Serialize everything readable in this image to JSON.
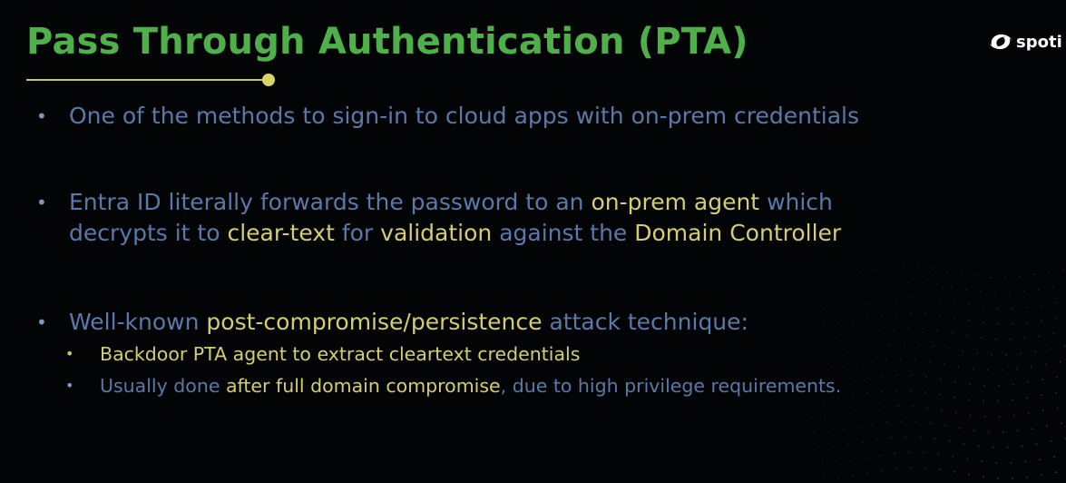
{
  "slide": {
    "title": "Pass Through Authentication (PTA)",
    "brand": {
      "name": "spoti",
      "icon": "spotit-swirl-logo-icon"
    },
    "colors": {
      "title": "#4fb04a",
      "body_text": "#5b79a8",
      "highlight": "#d4cf6e",
      "accent_line": "#c9c55a",
      "background": "#030406"
    },
    "bullet_glyph": "•",
    "bullets": [
      {
        "lines": [
          [
            {
              "text": "One of the methods to sign-in to cloud apps with on-prem credentials",
              "highlight": false
            }
          ]
        ]
      },
      {
        "lines": [
          [
            {
              "text": "Entra ID literally forwards the password to an ",
              "highlight": false
            },
            {
              "text": "on-prem agent",
              "highlight": true
            },
            {
              "text": " which",
              "highlight": false
            }
          ],
          [
            {
              "text": "decrypts it to ",
              "highlight": false
            },
            {
              "text": "clear-text",
              "highlight": true
            },
            {
              "text": " for ",
              "highlight": false
            },
            {
              "text": "validation",
              "highlight": true
            },
            {
              "text": " against the ",
              "highlight": false
            },
            {
              "text": "Domain Controller",
              "highlight": true
            }
          ]
        ]
      },
      {
        "lines": [
          [
            {
              "text": "Well-known ",
              "highlight": false
            },
            {
              "text": "post-compromise/persistence",
              "highlight": true
            },
            {
              "text": " attack technique:",
              "highlight": false
            }
          ]
        ],
        "sub_bullets": [
          {
            "mark_highlight": true,
            "segments": [
              {
                "text": "Backdoor PTA agent to extract cleartext credentials",
                "highlight": true
              }
            ]
          },
          {
            "mark_highlight": false,
            "segments": [
              {
                "text": "Usually done ",
                "highlight": false
              },
              {
                "text": "after full domain compromise",
                "highlight": true
              },
              {
                "text": ", due to high privilege requirements.",
                "highlight": false
              }
            ]
          }
        ]
      }
    ]
  }
}
